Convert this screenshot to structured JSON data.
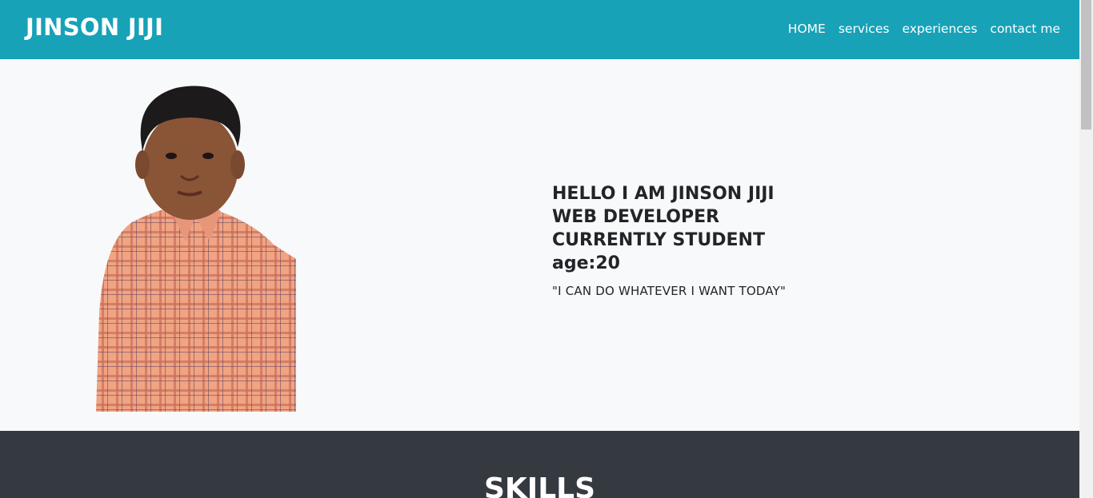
{
  "navbar": {
    "brand": "JINSON JIJI",
    "links": [
      {
        "label": "HOME"
      },
      {
        "label": "services"
      },
      {
        "label": "experiences"
      },
      {
        "label": "contact me"
      }
    ],
    "color": "#17a2b8"
  },
  "hero": {
    "lines": [
      "HELLO I AM JINSON JIJI",
      "WEB DEVELOPER",
      "CURRENTLY STUDENT",
      "age:20"
    ],
    "quote": "\"I CAN DO WHATEVER I WANT TODAY\""
  },
  "skills": {
    "title": "SKILLS",
    "color": "#343a40"
  }
}
